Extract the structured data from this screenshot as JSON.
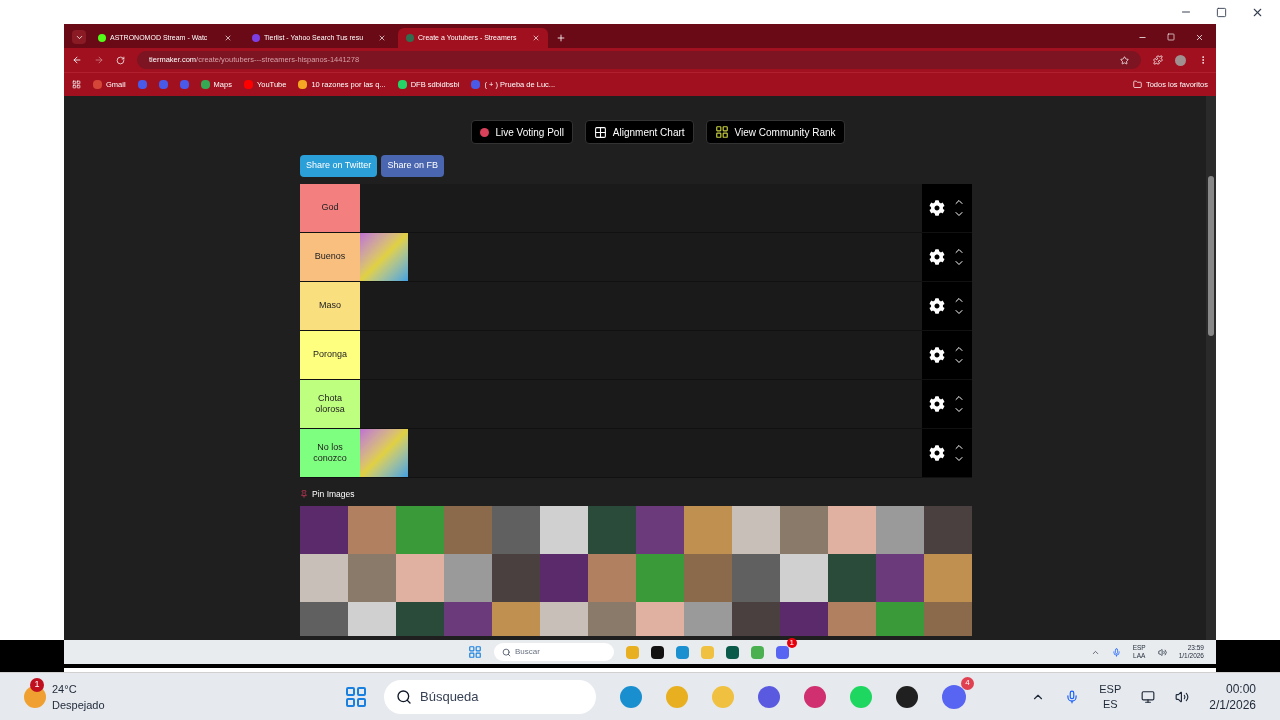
{
  "browser": {
    "tabs": [
      {
        "title": "ASTRONOMOD Stream - Watc",
        "selected": false,
        "color": "#53fc18"
      },
      {
        "title": "Tierlist - Yahoo Search Tus resu",
        "selected": false,
        "color": "#7b3fe4"
      },
      {
        "title": "Create a Youtubers - Streamers",
        "selected": true,
        "color": "#2f6f4f"
      }
    ],
    "url_host": "tiermaker.com",
    "url_path": "/create/youtubers---streamers-hispanos-1441278",
    "bookmarks": [
      {
        "kind": "mail",
        "label": "Gmail"
      },
      {
        "kind": "icon"
      },
      {
        "kind": "icon"
      },
      {
        "kind": "icon"
      },
      {
        "kind": "maps",
        "label": "Maps"
      },
      {
        "kind": "video",
        "label": "YouTube"
      },
      {
        "kind": "doc",
        "label": "10 razones por las q..."
      },
      {
        "kind": "chat",
        "label": "DFB sdbidbsbi"
      },
      {
        "kind": "app",
        "label": "( + ) Prueba de Luc..."
      }
    ],
    "all_bookmarks": "Todos los favoritos"
  },
  "page": {
    "actions": [
      {
        "kind": "poll",
        "label": "Live Voting Poll"
      },
      {
        "kind": "grid",
        "label": "Alignment Chart"
      },
      {
        "kind": "rank",
        "label": "View Community Rank"
      }
    ],
    "share": [
      {
        "kind": "twitter",
        "label": "Share on Twitter"
      },
      {
        "kind": "facebook",
        "label": "Share on FB"
      }
    ],
    "tiers": [
      {
        "label": "God",
        "color": "#f47f7f"
      },
      {
        "label": "Buenos",
        "color": "#f8bf7f",
        "items": [
          {
            "kind": "cartoon"
          }
        ]
      },
      {
        "label": "Maso",
        "color": "#fadf7f"
      },
      {
        "label": "Poronga",
        "color": "#ffff7f"
      },
      {
        "label": "Chota olorosa",
        "color": "#bfff7f"
      },
      {
        "label": "No los conozco",
        "color": "#7fff7f",
        "items": [
          {
            "kind": "cartoon"
          }
        ]
      }
    ],
    "pin_label": "Pin Images"
  },
  "inner_taskbar": {
    "search": "Buscar",
    "language": [
      "ESP",
      "LAA"
    ],
    "time": "23:59",
    "date": "1/1/2026",
    "discord_badge": "1"
  },
  "taskbar": {
    "weather_badge": "1",
    "temperature": "24°C",
    "condition": "Despejado",
    "search_placeholder": "Búsqueda",
    "discord_badge": "4",
    "language": [
      "ESP",
      "ES"
    ],
    "time": "00:00",
    "date": "2/1/2026"
  }
}
